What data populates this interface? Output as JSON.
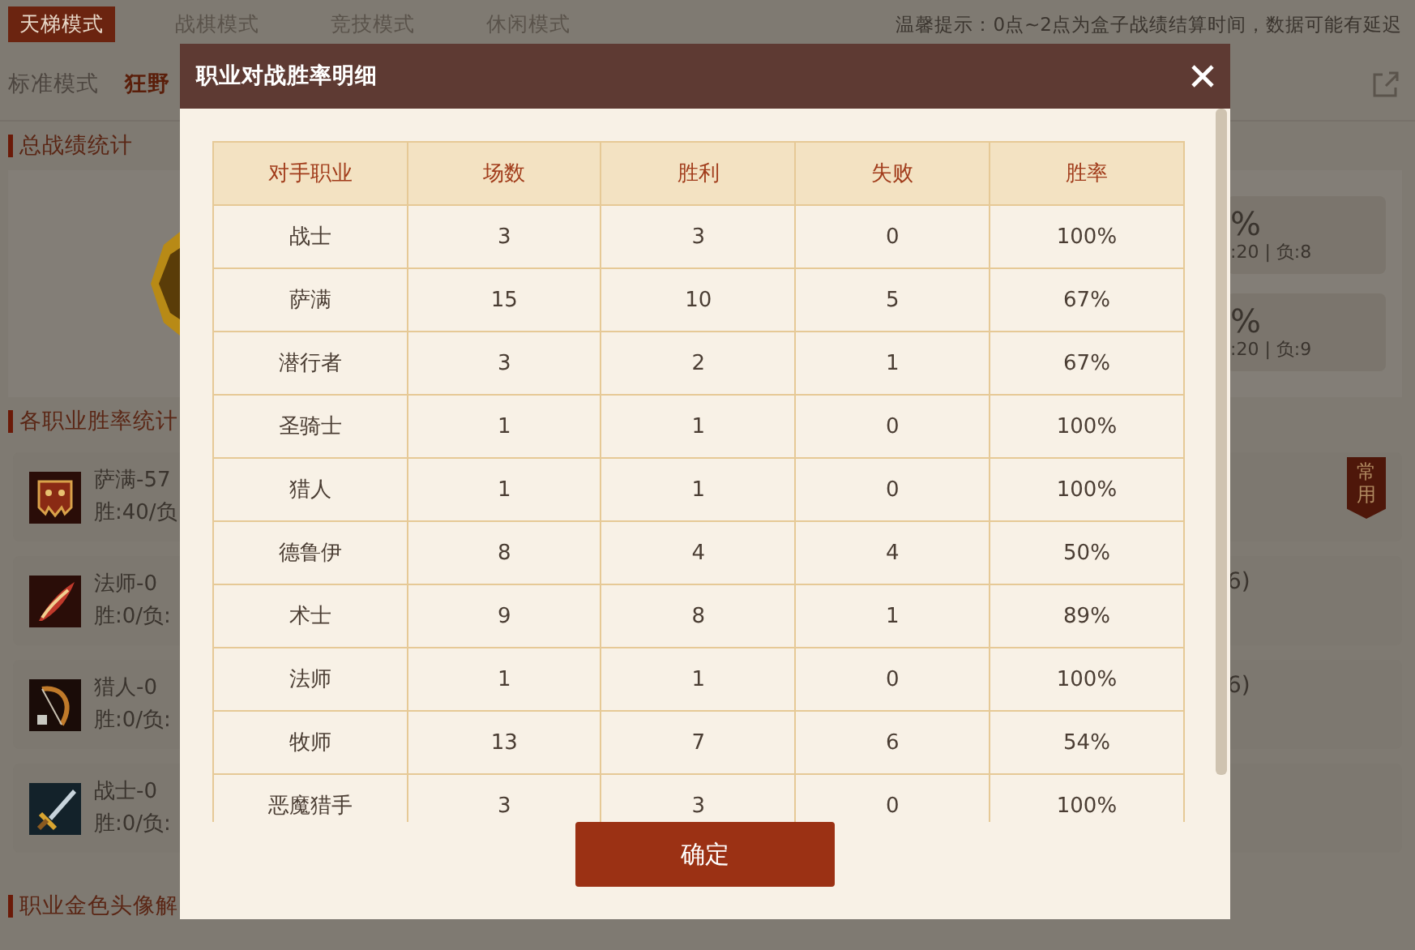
{
  "mode_tabs": [
    {
      "label": "天梯模式",
      "selected": true
    },
    {
      "label": "战棋模式",
      "selected": false
    },
    {
      "label": "竞技模式",
      "selected": false
    },
    {
      "label": "休闲模式",
      "selected": false
    }
  ],
  "notice": "温馨提示：0点~2点为盒子战绩结算时间，数据可能有延迟",
  "sub_tabs": [
    {
      "label": "标准模式",
      "selected": false
    },
    {
      "label": "狂野",
      "selected": true
    }
  ],
  "overall": {
    "heading": "总战绩统计",
    "cards": [
      {
        "rate": "%",
        "detail": ":20 | 负:8"
      },
      {
        "rate": "%",
        "detail": ":20 | 负:9"
      }
    ]
  },
  "classes": {
    "heading": "各职业胜率统计",
    "items": [
      {
        "title": "萨满-57",
        "record": "胜:40/负",
        "badge": "常用"
      },
      {
        "title": "法师-0",
        "record": "胜:0/负:",
        "extra": "6)"
      },
      {
        "title": "猎人-0",
        "record": "胜:0/负:",
        "extra": "6)"
      },
      {
        "title": "战士-0",
        "record": "胜:0/负:"
      }
    ]
  },
  "golden_heading": "职业金色头像解",
  "dialog": {
    "title": "职业对战胜率明细",
    "columns": [
      "对手职业",
      "场数",
      "胜利",
      "失败",
      "胜率"
    ],
    "rows": [
      [
        "战士",
        "3",
        "3",
        "0",
        "100%"
      ],
      [
        "萨满",
        "15",
        "10",
        "5",
        "67%"
      ],
      [
        "潜行者",
        "3",
        "2",
        "1",
        "67%"
      ],
      [
        "圣骑士",
        "1",
        "1",
        "0",
        "100%"
      ],
      [
        "猎人",
        "1",
        "1",
        "0",
        "100%"
      ],
      [
        "德鲁伊",
        "8",
        "4",
        "4",
        "50%"
      ],
      [
        "术士",
        "9",
        "8",
        "1",
        "89%"
      ],
      [
        "法师",
        "1",
        "1",
        "0",
        "100%"
      ],
      [
        "牧师",
        "13",
        "7",
        "6",
        "54%"
      ],
      [
        "恶魔猎手",
        "3",
        "3",
        "0",
        "100%"
      ]
    ],
    "button": "确定"
  }
}
